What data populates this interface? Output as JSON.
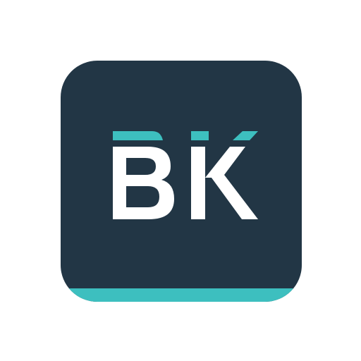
{
  "app_icon": {
    "logo_text": "BK",
    "colors": {
      "background": "#223645",
      "accent": "#3dbfbf",
      "letters": "#ffffff"
    }
  }
}
